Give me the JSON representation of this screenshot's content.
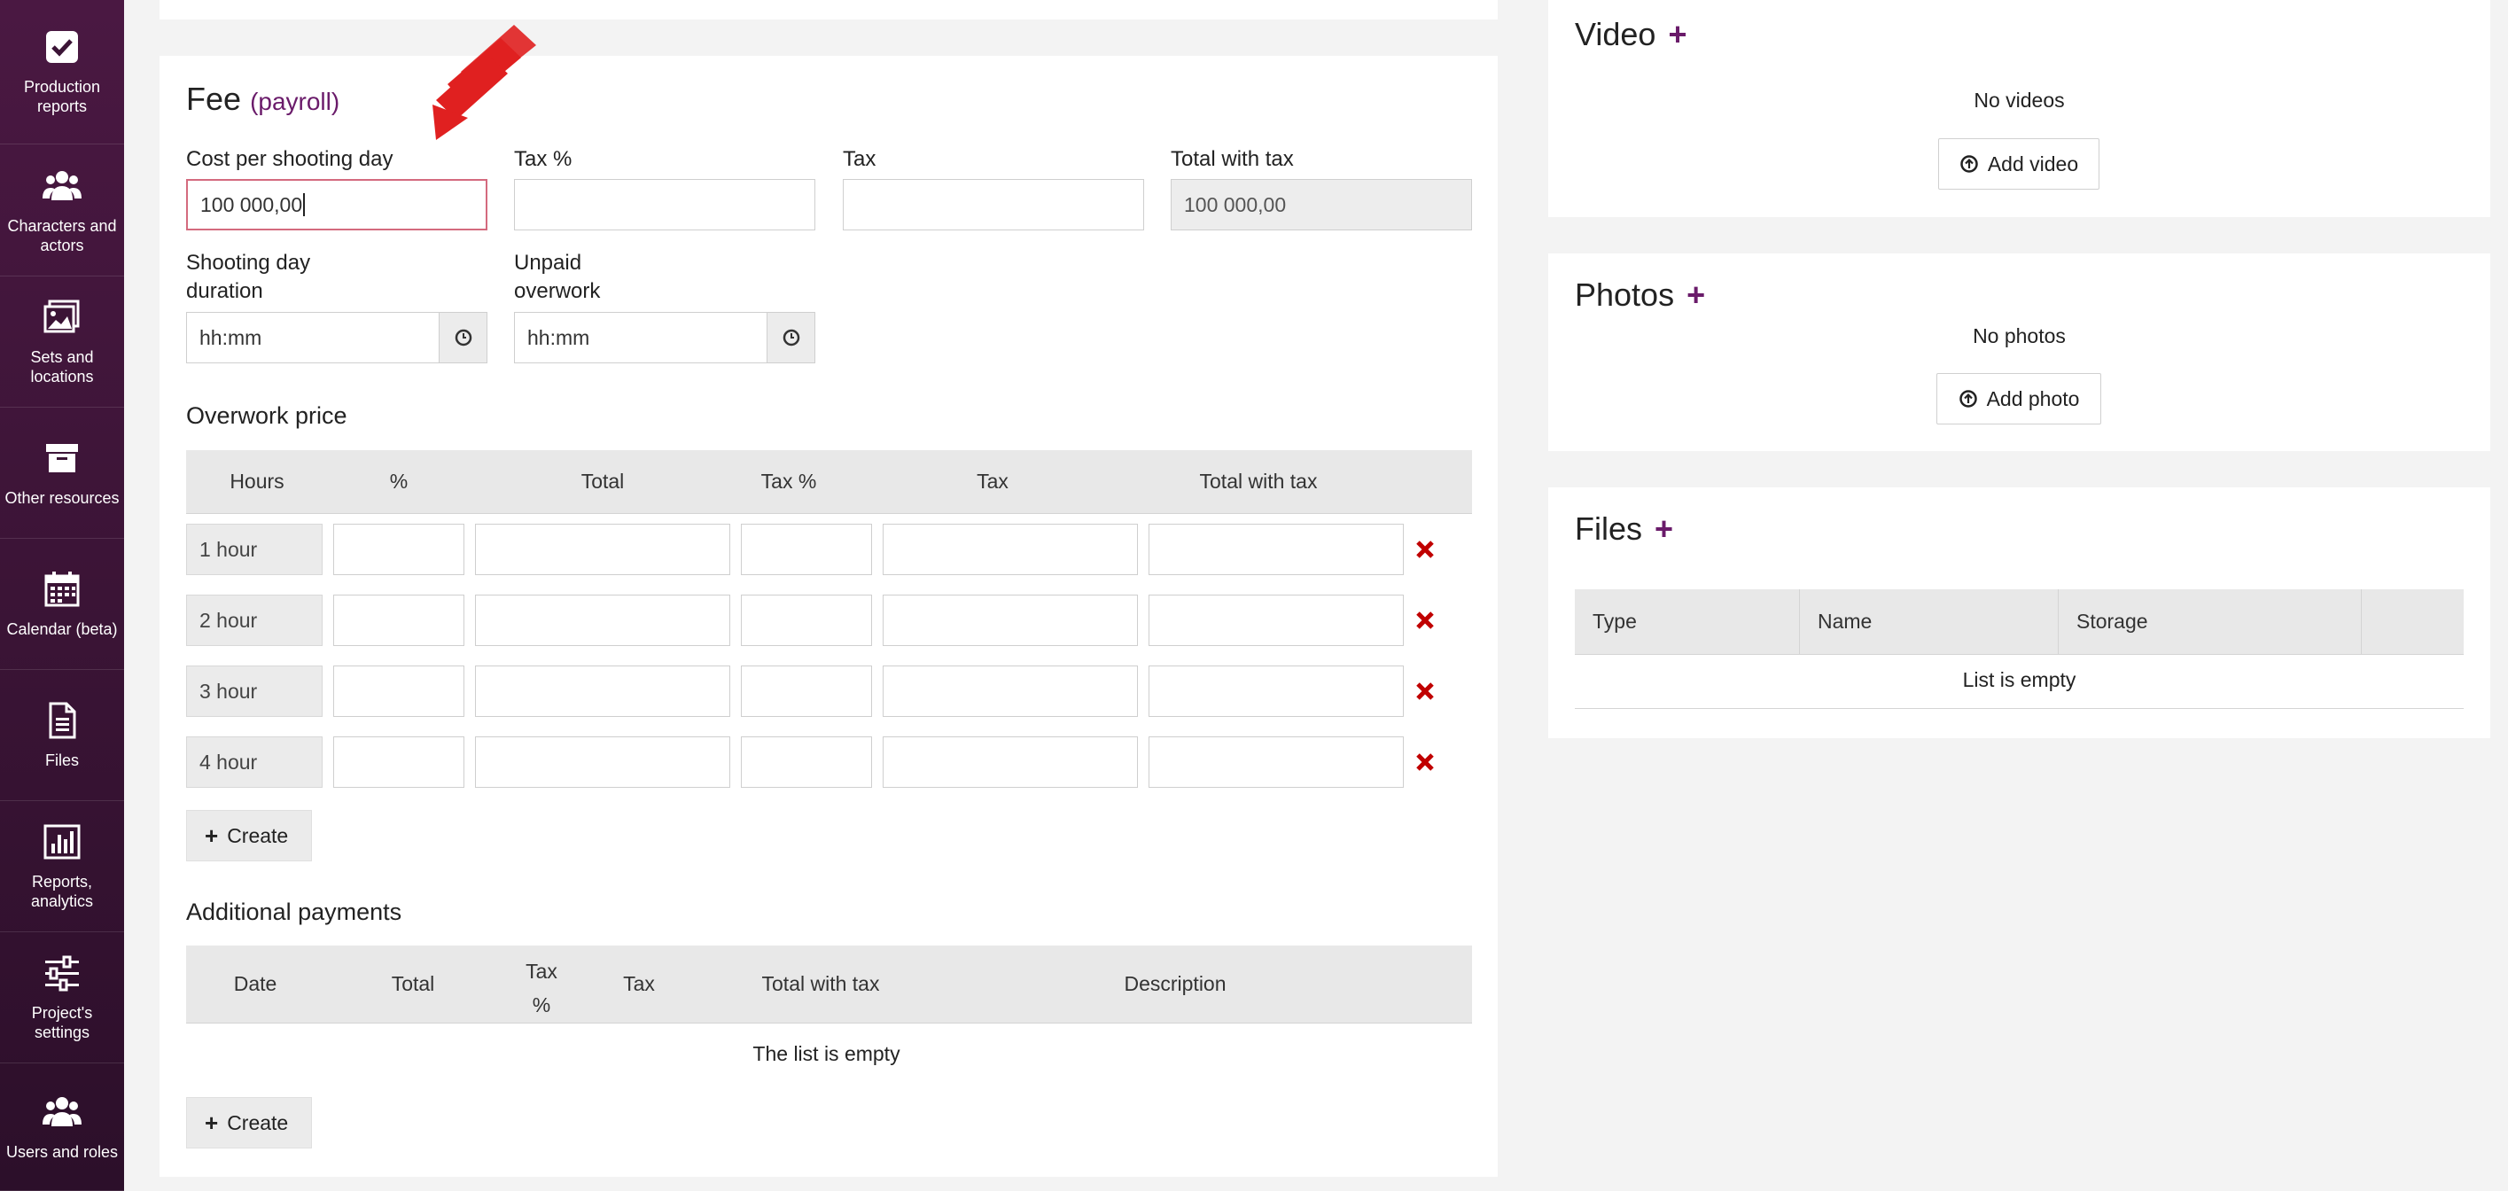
{
  "sidebar": {
    "items": [
      {
        "label": "Production reports",
        "icon": "checkbox-icon"
      },
      {
        "label": "Characters and actors",
        "icon": "users-icon"
      },
      {
        "label": "Sets and locations",
        "icon": "image-icon"
      },
      {
        "label": "Other resources",
        "icon": "archive-icon"
      },
      {
        "label": "Calendar (beta)",
        "icon": "calendar-icon"
      },
      {
        "label": "Files",
        "icon": "file-icon"
      },
      {
        "label": "Reports, analytics",
        "icon": "chart-icon"
      },
      {
        "label": "Project's settings",
        "icon": "sliders-icon"
      },
      {
        "label": "Users and roles",
        "icon": "users-icon"
      }
    ]
  },
  "fee": {
    "title": "Fee",
    "subtitle": "(payroll)",
    "cost_label": "Cost per shooting day",
    "cost_value": "100 000,00",
    "taxpct_label": "Tax %",
    "tax_label": "Tax",
    "total_label": "Total with tax",
    "total_value": "100 000,00",
    "duration_label_1": "Shooting day",
    "duration_label_2": "duration",
    "duration_placeholder": "hh:mm",
    "overwork_label_1": "Unpaid",
    "overwork_label_2": "overwork",
    "overwork_placeholder": "hh:mm"
  },
  "overwork": {
    "title": "Overwork price",
    "headers": [
      "Hours",
      "%",
      "Total",
      "Tax %",
      "Tax",
      "Total with tax"
    ],
    "rows": [
      "1 hour",
      "2 hour",
      "3 hour",
      "4 hour"
    ],
    "create_label": "Create"
  },
  "additional": {
    "title": "Additional payments",
    "headers": [
      "Date",
      "Total",
      "Tax",
      "%",
      "Tax",
      "Total with tax",
      "Description"
    ],
    "empty_text": "The list is empty",
    "create_label": "Create"
  },
  "video": {
    "title": "Video",
    "empty_text": "No videos",
    "add_label": "Add video"
  },
  "photos": {
    "title": "Photos",
    "empty_text": "No photos",
    "add_label": "Add photo"
  },
  "files": {
    "title": "Files",
    "headers": [
      "Type",
      "Name",
      "Storage"
    ],
    "empty_text": "List is empty"
  },
  "colors": {
    "accent": "#6a1b6a",
    "delete": "#c00000",
    "arrow": "#e02020"
  }
}
